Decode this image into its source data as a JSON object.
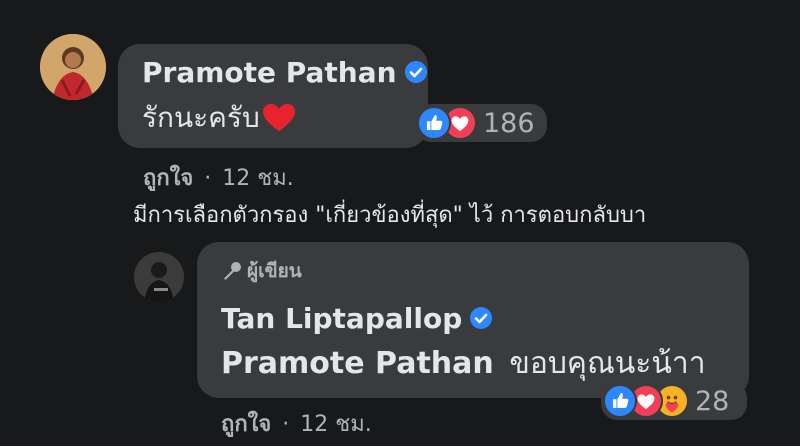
{
  "comment": {
    "author": "Pramote Pathan",
    "text": "รักนะครับ",
    "emoji": "heart-icon",
    "reaction_count": "186",
    "reactions": [
      "like-icon",
      "love-icon"
    ],
    "like_label": "ถูกใจ",
    "separator": "·",
    "time": "12 ชม."
  },
  "filter_note": "มีการเลือกตัวกรอง \"เกี่ยวข้องที่สุด\" ไว้ การตอบกลับบา",
  "reply": {
    "badge_label": "ผู้เขียน",
    "author": "Tan Liptapallop",
    "mention": "Pramote Pathan",
    "text": "ขอบคุณนะน้าา",
    "reaction_count": "28",
    "reactions": [
      "like-icon",
      "love-icon",
      "care-icon"
    ],
    "like_label": "ถูกใจ",
    "separator": "·",
    "time": "12 ชม."
  },
  "colors": {
    "background": "#18191a",
    "bubble": "#3a3b3c",
    "verified": "#2d88ff",
    "like": "#2d88ff",
    "love": "#f33e58",
    "care": "#f7b125"
  }
}
